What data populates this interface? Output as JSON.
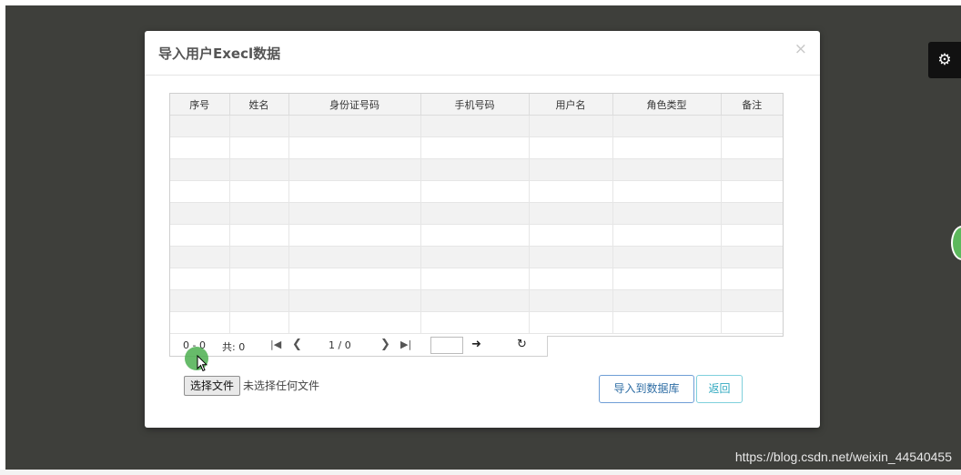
{
  "modal": {
    "title": "导入用户Execl数据",
    "close": "×"
  },
  "table": {
    "columns": [
      "序号",
      "姓名",
      "身份证号码",
      "手机号码",
      "用户名",
      "角色类型",
      "备注"
    ],
    "rows": []
  },
  "pager": {
    "range": "0 - 0",
    "total": "共: 0",
    "first": "|◀",
    "prev": "❮",
    "page": "1 / 0",
    "next": "❯",
    "last": "▶|",
    "go": "➜",
    "refresh": "↻",
    "page_input_value": ""
  },
  "file": {
    "button_label": "选择文件",
    "status": "未选择任何文件"
  },
  "actions": {
    "import_label": "导入到数据库",
    "back_label": "返回"
  },
  "settings": {
    "icon": "gear-icon",
    "glyph": "⚙"
  },
  "watermark": "https://blog.csdn.net/weixin_44540455"
}
